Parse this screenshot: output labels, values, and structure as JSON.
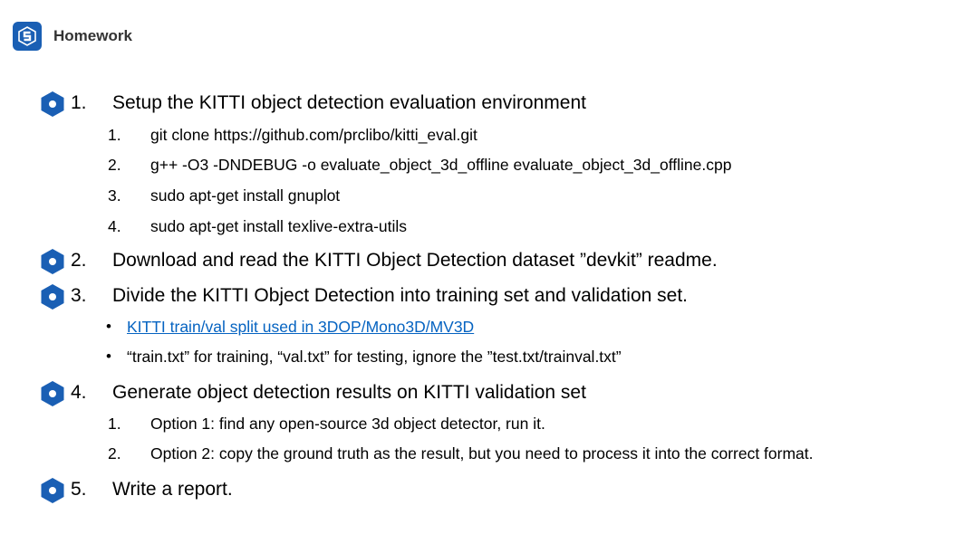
{
  "header": {
    "title": "Homework"
  },
  "colors": {
    "accent": "#1a5fb4",
    "link": "#0563c1"
  },
  "items": [
    {
      "num": "1.",
      "text": "Setup the KITTI object detection evaluation environment",
      "sub": [
        {
          "num": "1.",
          "text": "git clone https://github.com/prclibo/kitti_eval.git"
        },
        {
          "num": "2.",
          "text": "g++ -O3 -DNDEBUG -o evaluate_object_3d_offline evaluate_object_3d_offline.cpp"
        },
        {
          "num": "3.",
          "text": "sudo apt-get install gnuplot"
        },
        {
          "num": "4.",
          "text": "sudo apt-get install texlive-extra-utils"
        }
      ]
    },
    {
      "num": "2.",
      "text": "Download and read the KITTI Object Detection dataset ”devkit” readme."
    },
    {
      "num": "3.",
      "text": "Divide the KITTI Object Detection into training set and validation set.",
      "bullets": [
        {
          "dot": "•",
          "text": "KITTI train/val split used in 3DOP/Mono3D/MV3D"
        },
        {
          "dot": "•",
          "text": "“train.txt” for training, “val.txt” for testing, ignore the ”test.txt/trainval.txt”"
        }
      ]
    },
    {
      "num": "4.",
      "text": "Generate object detection results on KITTI validation set",
      "sub": [
        {
          "num": "1.",
          "text": "Option 1: find any open-source 3d object detector, run it."
        },
        {
          "num": "2.",
          "text": "Option 2: copy the ground truth as the result, but you need to process it into the correct format."
        }
      ]
    },
    {
      "num": "5.",
      "text": "Write a report."
    }
  ]
}
